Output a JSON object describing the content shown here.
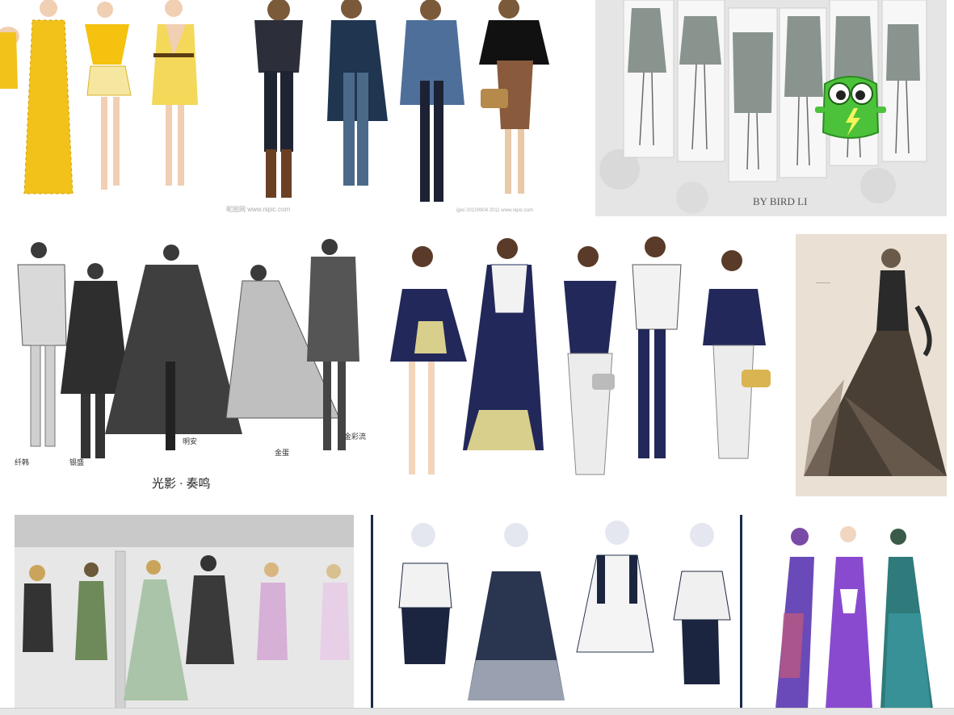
{
  "gallery": {
    "tiles": [
      {
        "id": "yellow-dresses"
      },
      {
        "id": "denim-outfits",
        "watermark_left": "昵图网 www.nipic.com",
        "watermark_right": "ijpoi 20100904 2011 www.nipic.com"
      },
      {
        "id": "grey-croquis",
        "caption": "BY BIRD LI"
      },
      {
        "id": "monochrome-collection",
        "caption": "光影 · 奏鸣",
        "labels": [
          "纤韩",
          "银盛",
          "明安",
          "金蛋",
          "金彩流"
        ]
      },
      {
        "id": "navy-collection"
      },
      {
        "id": "black-ballgown"
      },
      {
        "id": "wall-sketches"
      },
      {
        "id": "ruffle-collection"
      },
      {
        "id": "purple-gowns"
      }
    ]
  },
  "badge": {
    "icon": "robot-battery-icon"
  },
  "colors": {
    "accent_yellow": "#f2c21a",
    "navy": "#23285a",
    "badge_green": "#4cc23a"
  }
}
